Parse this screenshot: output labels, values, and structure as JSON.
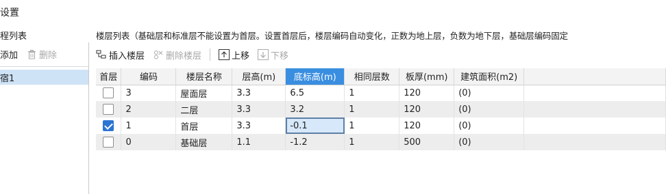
{
  "dialog_title": "设置",
  "left": {
    "header": "程列表",
    "add_label": "添加",
    "delete_label": "删除",
    "items": [
      "宿1"
    ]
  },
  "right": {
    "header": "楼层列表（基础层和标准层不能设置为首层。设置首层后，楼层编码自动变化，正数为地上层，负数为地下层，基础层编码固定",
    "toolbar": {
      "insert_label": "插入楼层",
      "delete_label": "删除楼层",
      "up_label": "上移",
      "down_label": "下移"
    },
    "columns": [
      "首层",
      "编码",
      "楼层名称",
      "层高(m)",
      "底标高(m)",
      "相同层数",
      "板厚(mm)",
      "建筑面积(m2)"
    ],
    "rows": [
      {
        "first": false,
        "code": "3",
        "name": "屋面层",
        "height": "3.3",
        "base": "6.5",
        "same": "1",
        "thick": "120",
        "area": "(0)"
      },
      {
        "first": false,
        "code": "2",
        "name": "二层",
        "height": "3.3",
        "base": "3.2",
        "same": "1",
        "thick": "120",
        "area": "(0)"
      },
      {
        "first": true,
        "code": "1",
        "name": "首层",
        "height": "3.3",
        "base": "-0.1",
        "same": "1",
        "thick": "120",
        "area": "(0)"
      },
      {
        "first": false,
        "code": "0",
        "name": "基础层",
        "height": "1.1",
        "base": "-1.2",
        "same": "1",
        "thick": "500",
        "area": "(0)"
      }
    ]
  },
  "colors": {
    "header_highlight": "#3a8ee0",
    "selected_item": "#cfe3f7",
    "checkbox_on": "#2b74d3"
  }
}
